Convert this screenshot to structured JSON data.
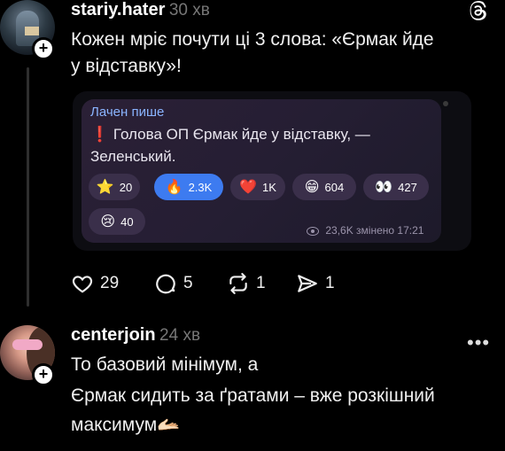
{
  "post1": {
    "username": "stariy.hater",
    "time": "30 хв",
    "text_line1": "Кожен мріє почути ці 3 слова: «Єрмак йде",
    "text_line2": "у відставку»!",
    "embed": {
      "author": "Лачен пише",
      "message_line1": "Голова ОП Єрмак йде у відставку, —",
      "message_line2": "Зеленський.",
      "reactions": [
        {
          "emoji": "⭐",
          "count": "20"
        },
        {
          "emoji": "🔥",
          "count": "2.3K"
        },
        {
          "emoji": "❤️",
          "count": "1K"
        },
        {
          "emoji": "😁",
          "count": "604"
        },
        {
          "emoji": "👀",
          "count": "427"
        },
        {
          "emoji": "😢",
          "count": "40"
        }
      ],
      "meta": "23,6K змінено 17:21"
    },
    "actions": {
      "likes": "29",
      "comments": "5",
      "reposts": "1",
      "shares": "1"
    }
  },
  "post2": {
    "username": "centerjoin",
    "time": "24 хв",
    "text_line1": "То базовий мінімум, а",
    "text_line2": "Єрмак сидить за ґратами – вже розкішний",
    "text_line3": "максимум🫴🏻"
  },
  "icons": {
    "plus": "+",
    "more": "•••",
    "exclamation": "❗"
  }
}
